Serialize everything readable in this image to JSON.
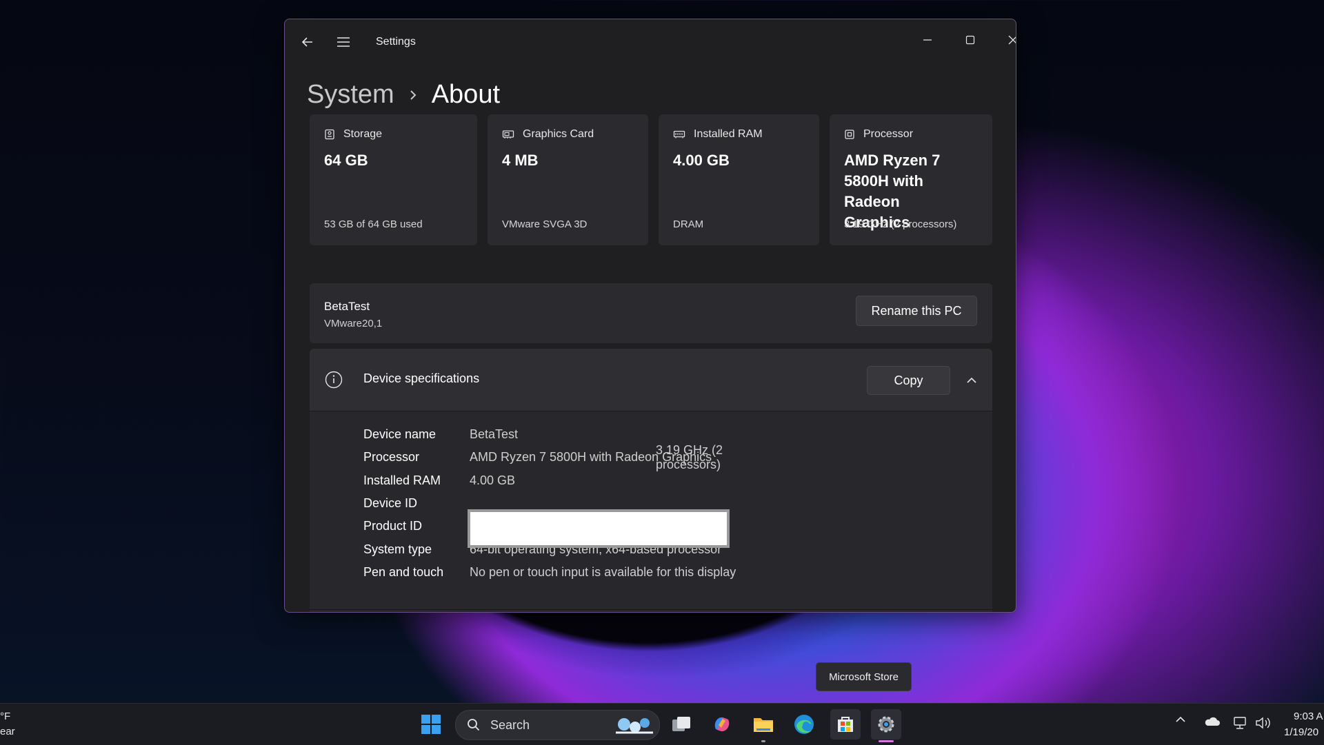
{
  "window": {
    "app_title": "Settings"
  },
  "breadcrumb": {
    "parent": "System",
    "current": "About"
  },
  "cards": [
    {
      "label": "Storage",
      "value": "64 GB",
      "sub": "53 GB of 64 GB used",
      "icon": "storage-icon"
    },
    {
      "label": "Graphics Card",
      "value": "4 MB",
      "sub": "VMware SVGA 3D",
      "icon": "graphics-card-icon"
    },
    {
      "label": "Installed RAM",
      "value": "4.00 GB",
      "sub": "DRAM",
      "icon": "ram-icon"
    },
    {
      "label": "Processor",
      "value": "AMD Ryzen 7 5800H with Radeon Graphics",
      "sub": "3.19 GHz (2 processors)",
      "icon": "processor-icon"
    }
  ],
  "pc": {
    "name": "BetaTest",
    "model": "VMware20,1",
    "rename_label": "Rename this PC"
  },
  "specs": {
    "title": "Device specifications",
    "copy_label": "Copy",
    "rows": [
      {
        "label": "Device name",
        "value": "BetaTest",
        "extra": ""
      },
      {
        "label": "Processor",
        "value": "AMD Ryzen 7 5800H with Radeon Graphics",
        "extra": "3.19 GHz  (2 processors)"
      },
      {
        "label": "Installed RAM",
        "value": "4.00 GB",
        "extra": ""
      },
      {
        "label": "Device ID",
        "value": "",
        "extra": ""
      },
      {
        "label": "Product ID",
        "value": "",
        "extra": ""
      },
      {
        "label": "System type",
        "value": "64-bit operating system, x64-based processor",
        "extra": ""
      },
      {
        "label": "Pen and touch",
        "value": "No pen or touch input is available for this display",
        "extra": ""
      }
    ]
  },
  "tooltip": {
    "text": "Microsoft Store"
  },
  "taskbar": {
    "weather_temp": "°F",
    "weather_desc": "ear",
    "search_placeholder": "Search",
    "time": "9:03 A",
    "date": "1/19/20"
  },
  "colors": {
    "accent": "#d27be0",
    "window_bg": "#1f1f22",
    "card_bg": "#2b2b2f"
  }
}
